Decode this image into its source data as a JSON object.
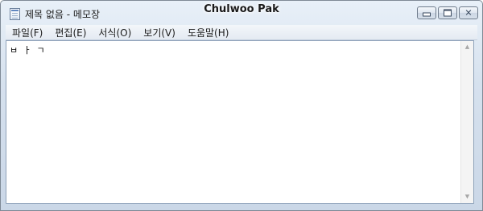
{
  "window": {
    "title": "제목 없음 - 메모장",
    "user_name": "Chulwoo Pak",
    "controls": {
      "minimize": "minimize",
      "maximize": "maximize",
      "close": "✕"
    }
  },
  "menu": {
    "items": [
      {
        "label": "파일(F)"
      },
      {
        "label": "편집(E)"
      },
      {
        "label": "서식(O)"
      },
      {
        "label": "보기(V)"
      },
      {
        "label": "도움말(H)"
      }
    ]
  },
  "editor": {
    "text": "ㅂ ㅏ ㄱ"
  },
  "scrollbar": {
    "up_arrow": "▲",
    "down_arrow": "▼"
  },
  "icons": {
    "app": "notepad-icon"
  }
}
